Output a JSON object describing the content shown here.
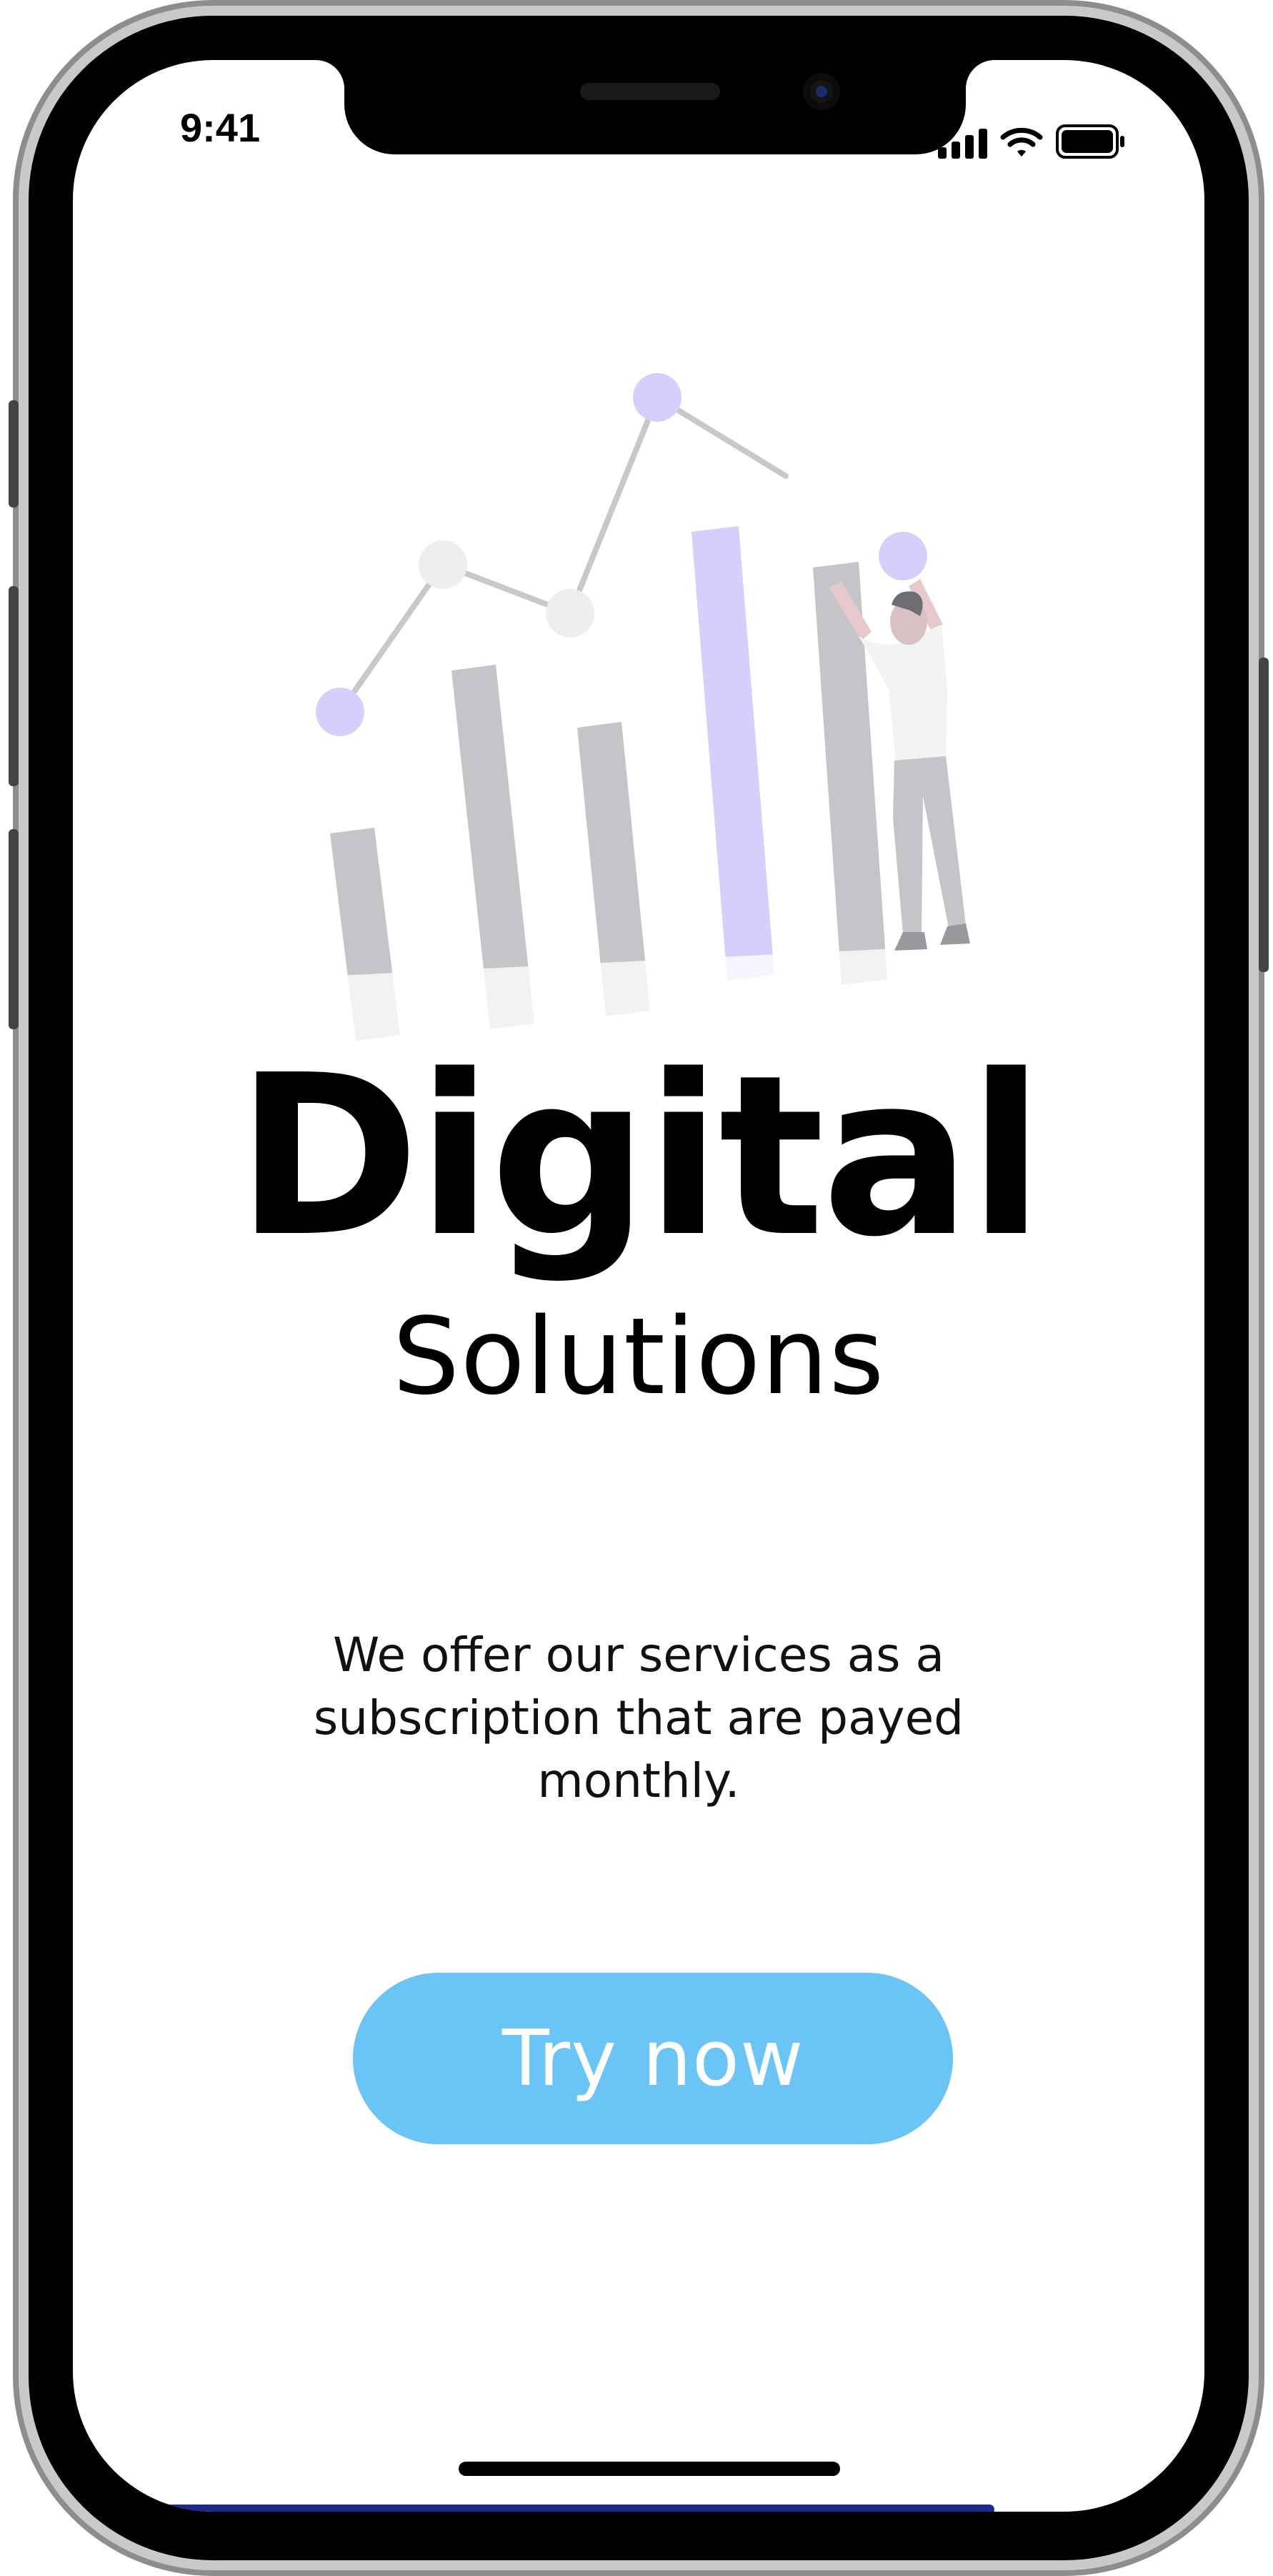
{
  "status_bar": {
    "time": "9:41",
    "icons": [
      "cellular-signal-icon",
      "wifi-icon",
      "battery-icon"
    ]
  },
  "hero": {
    "illustration": "analytics-growth-chart-illustration"
  },
  "headline": {
    "title": "Digital",
    "subtitle": "Solutions"
  },
  "description": "We offer our services as a subscription that are payed monthly.",
  "cta": {
    "label": "Try now"
  },
  "colors": {
    "accent_button": "#6ac4f6",
    "lavender": "#d4d0fb",
    "bar_gray": "#c5c5c9",
    "text": "#000000",
    "background": "#ffffff"
  }
}
